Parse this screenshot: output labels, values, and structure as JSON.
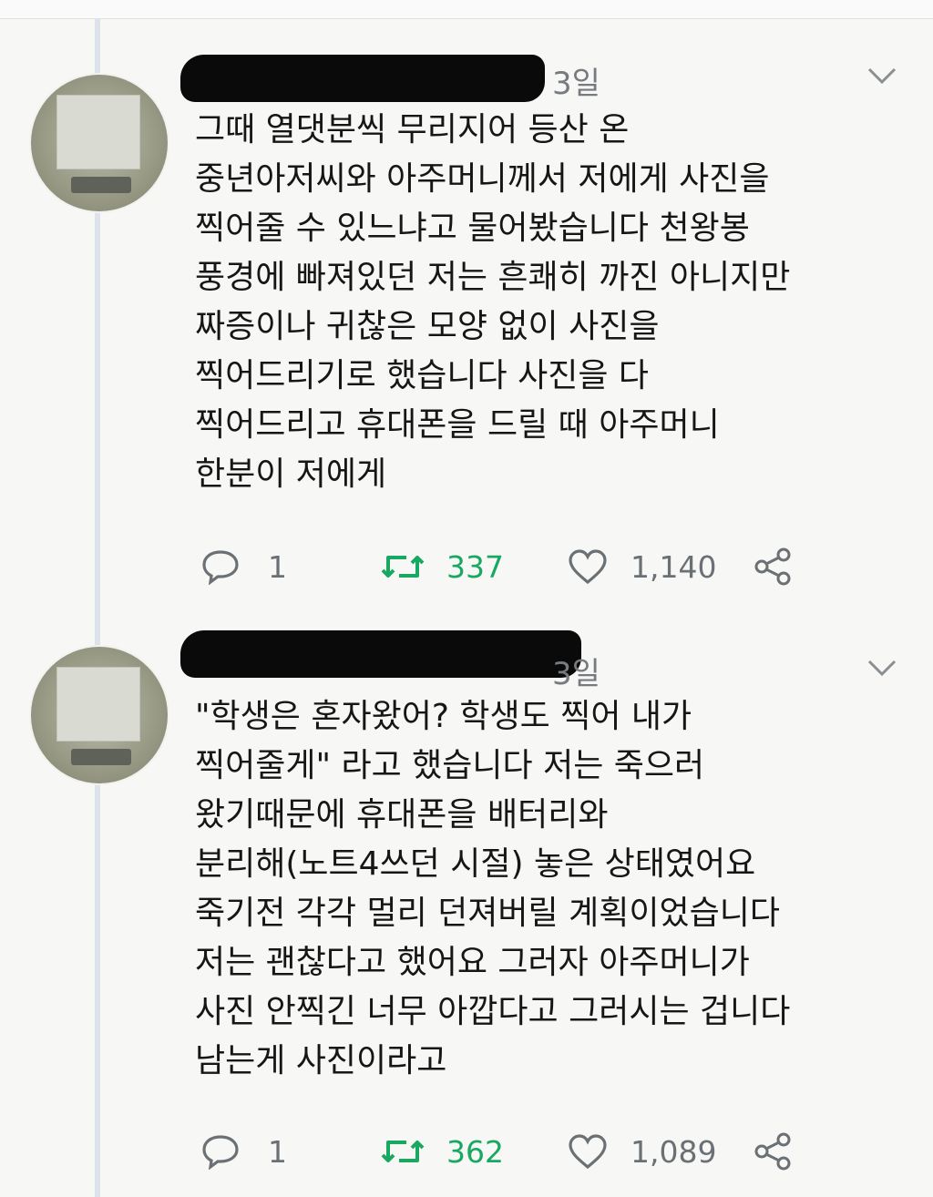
{
  "tweets": [
    {
      "time": "3일",
      "text": "그때 열댓분씩 무리지어 등산 온\n중년아저씨와 아주머니께서 저에게 사진을\n찍어줄 수 있느냐고 물어봤습니다 천왕봉\n풍경에 빠져있던 저는 흔쾌히 까진 아니지만\n짜증이나 귀찮은 모양 없이 사진을\n찍어드리기로 했습니다 사진을 다\n찍어드리고 휴대폰을 드릴 때 아주머니\n한분이 저에게",
      "reply_count": "1",
      "retweet_count": "337",
      "like_count": "1,140"
    },
    {
      "time": "3일",
      "text": "\"학생은 혼자왔어? 학생도 찍어 내가\n찍어줄게\" 라고 했습니다 저는 죽으러\n왔기때문에 휴대폰을 배터리와\n분리해(노트4쓰던 시절) 놓은 상태였어요\n죽기전 각각 멀리 던져버릴 계획이었습니다\n저는 괜찮다고 했어요 그러자 아주머니가\n사진 안찍긴 너무 아깝다고 그러시는 겁니다\n남는게 사진이라고",
      "reply_count": "1",
      "retweet_count": "362",
      "like_count": "1,089"
    }
  ],
  "colors": {
    "retweet": "#19a862",
    "icon_gray": "#6b7075",
    "redaction": "#0a0a0a"
  },
  "icons": {
    "reply": "reply-icon",
    "retweet": "retweet-icon",
    "like": "heart-icon",
    "share": "share-icon",
    "menu": "chevron-down-icon"
  }
}
